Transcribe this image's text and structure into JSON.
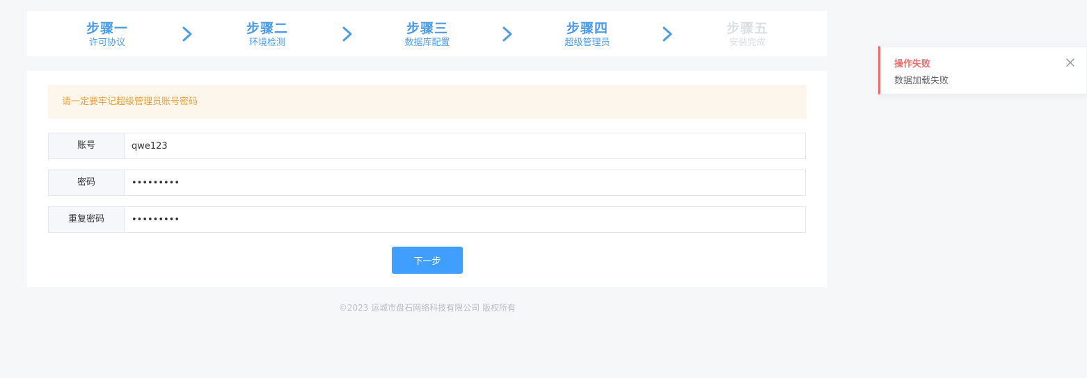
{
  "steps": [
    {
      "title": "步骤一",
      "subtitle": "许可协议"
    },
    {
      "title": "步骤二",
      "subtitle": "环境检测"
    },
    {
      "title": "步骤三",
      "subtitle": "数据库配置"
    },
    {
      "title": "步骤四",
      "subtitle": "超级管理员"
    },
    {
      "title": "步骤五",
      "subtitle": "安装完成"
    }
  ],
  "colors": {
    "active": "#4a9be8",
    "inactive": "#dcdfe3",
    "warning_text": "#e6a23c",
    "warning_bg": "#fdf6ec",
    "primary": "#409eff",
    "error": "#f56c6c"
  },
  "form": {
    "warning": "请一定要牢记超级管理员账号密码",
    "account_label": "账号",
    "account_value": "qwe123",
    "password_label": "密码",
    "password_value": "•••••••••",
    "repeat_label": "重复密码",
    "repeat_value": "•••••••••",
    "next_label": "下一步"
  },
  "footer": "©2023 运城市盘石网络科技有限公司 版权所有",
  "toast": {
    "title": "操作失败",
    "message": "数据加载失败",
    "close_icon": "close-icon"
  }
}
